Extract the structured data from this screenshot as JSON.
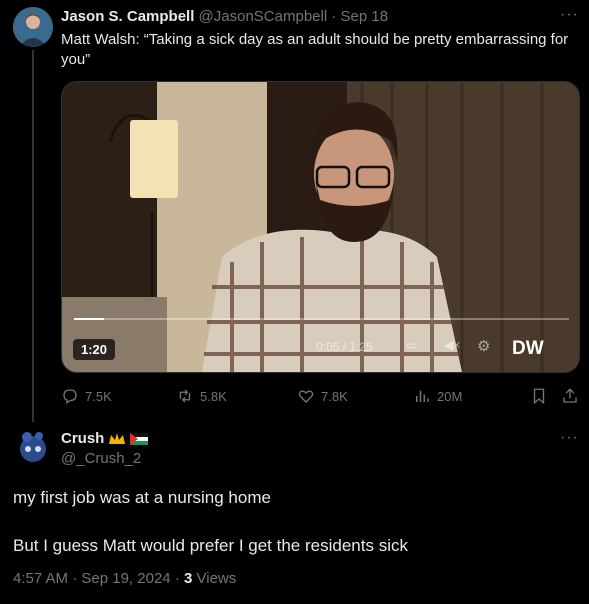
{
  "tweet": {
    "name": "Jason S. Campbell",
    "handle": "@JasonSCampbell",
    "separator": "·",
    "date": "Sep 18",
    "more": "···",
    "text": "Matt Walsh: “Taking a sick day as an adult should be pretty embarrassing for you”",
    "video": {
      "duration": "1:20",
      "elapsed": "0:05 / 1:25",
      "logo": "DW",
      "progress": 0.06
    },
    "actions": {
      "replies": "7.5K",
      "reposts": "5.8K",
      "likes": "7.8K",
      "views": "20M"
    }
  },
  "reply": {
    "name": "Crush",
    "badges": [
      "crown-emoji",
      "palestine-flag"
    ],
    "handle": "@_Crush_2",
    "more": "···",
    "line1": "my first job was at a nursing home",
    "line2": "But I guess Matt would prefer I get the residents sick",
    "time": "4:57 AM",
    "separator": "·",
    "date": "Sep 19, 2024",
    "views_count": "3",
    "views_label": "Views"
  },
  "colors": {
    "background": "#000000",
    "text": "#e7e9ea",
    "muted": "#71767b",
    "divider": "#2f3336"
  }
}
